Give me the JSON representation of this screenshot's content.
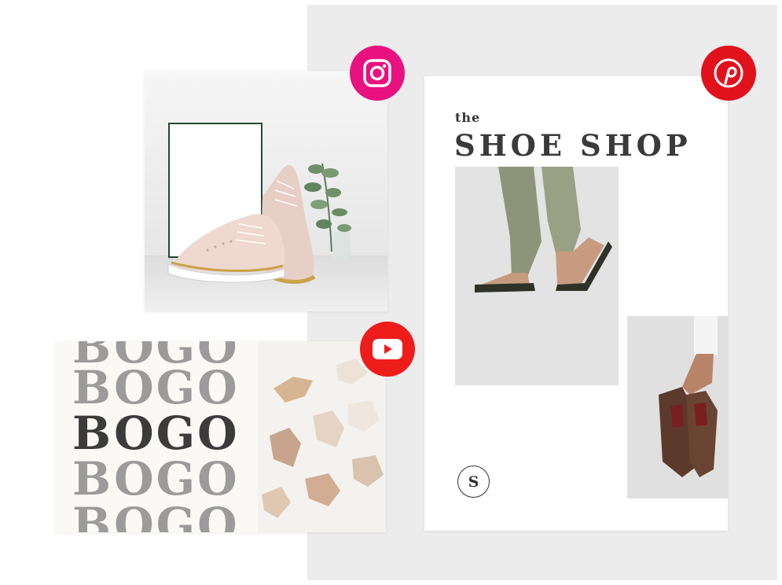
{
  "pinterest_post": {
    "title_small": "the",
    "title_large": "SHOE SHOP",
    "logo_letter": "S"
  },
  "youtube_post": {
    "bogo_lines": [
      "BOGO",
      "BOGO",
      "BOGO",
      "BOGO",
      "BOGO"
    ]
  },
  "social_badges": {
    "instagram_icon": "instagram-icon",
    "pinterest_icon": "pinterest-icon",
    "youtube_icon": "youtube-play-icon"
  },
  "colors": {
    "instagram": "#e8117f",
    "pinterest": "#e1121c",
    "youtube": "#ef1c1c",
    "background": "#ececed",
    "bogo_dark": "#3b3b3b",
    "bogo_light": "#9b9b9b"
  }
}
